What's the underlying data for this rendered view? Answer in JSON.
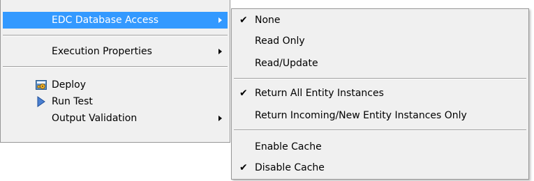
{
  "main_menu": {
    "items": [
      {
        "label": "EDC Database Access",
        "submenu": true,
        "highlighted": true
      },
      {
        "label": "Execution Properties",
        "submenu": true
      },
      {
        "label": "Deploy",
        "icon": "deploy-icon"
      },
      {
        "label": "Run Test",
        "icon": "run-test-icon"
      },
      {
        "label": "Output Validation",
        "submenu": true
      }
    ]
  },
  "sub_menu": {
    "items": [
      {
        "label": "None",
        "checked": true
      },
      {
        "label": "Read Only",
        "checked": false
      },
      {
        "label": "Read/Update",
        "checked": false
      },
      {
        "label": "Return All Entity Instances",
        "checked": true
      },
      {
        "label": "Return Incoming/New Entity Instances Only",
        "checked": false
      },
      {
        "label": "Enable Cache",
        "checked": false
      },
      {
        "label": "Disable Cache",
        "checked": true
      }
    ],
    "check_glyph": "✔"
  },
  "colors": {
    "highlight": "#3399ff",
    "menu_background": "#f0f0f0",
    "border": "#979797"
  }
}
